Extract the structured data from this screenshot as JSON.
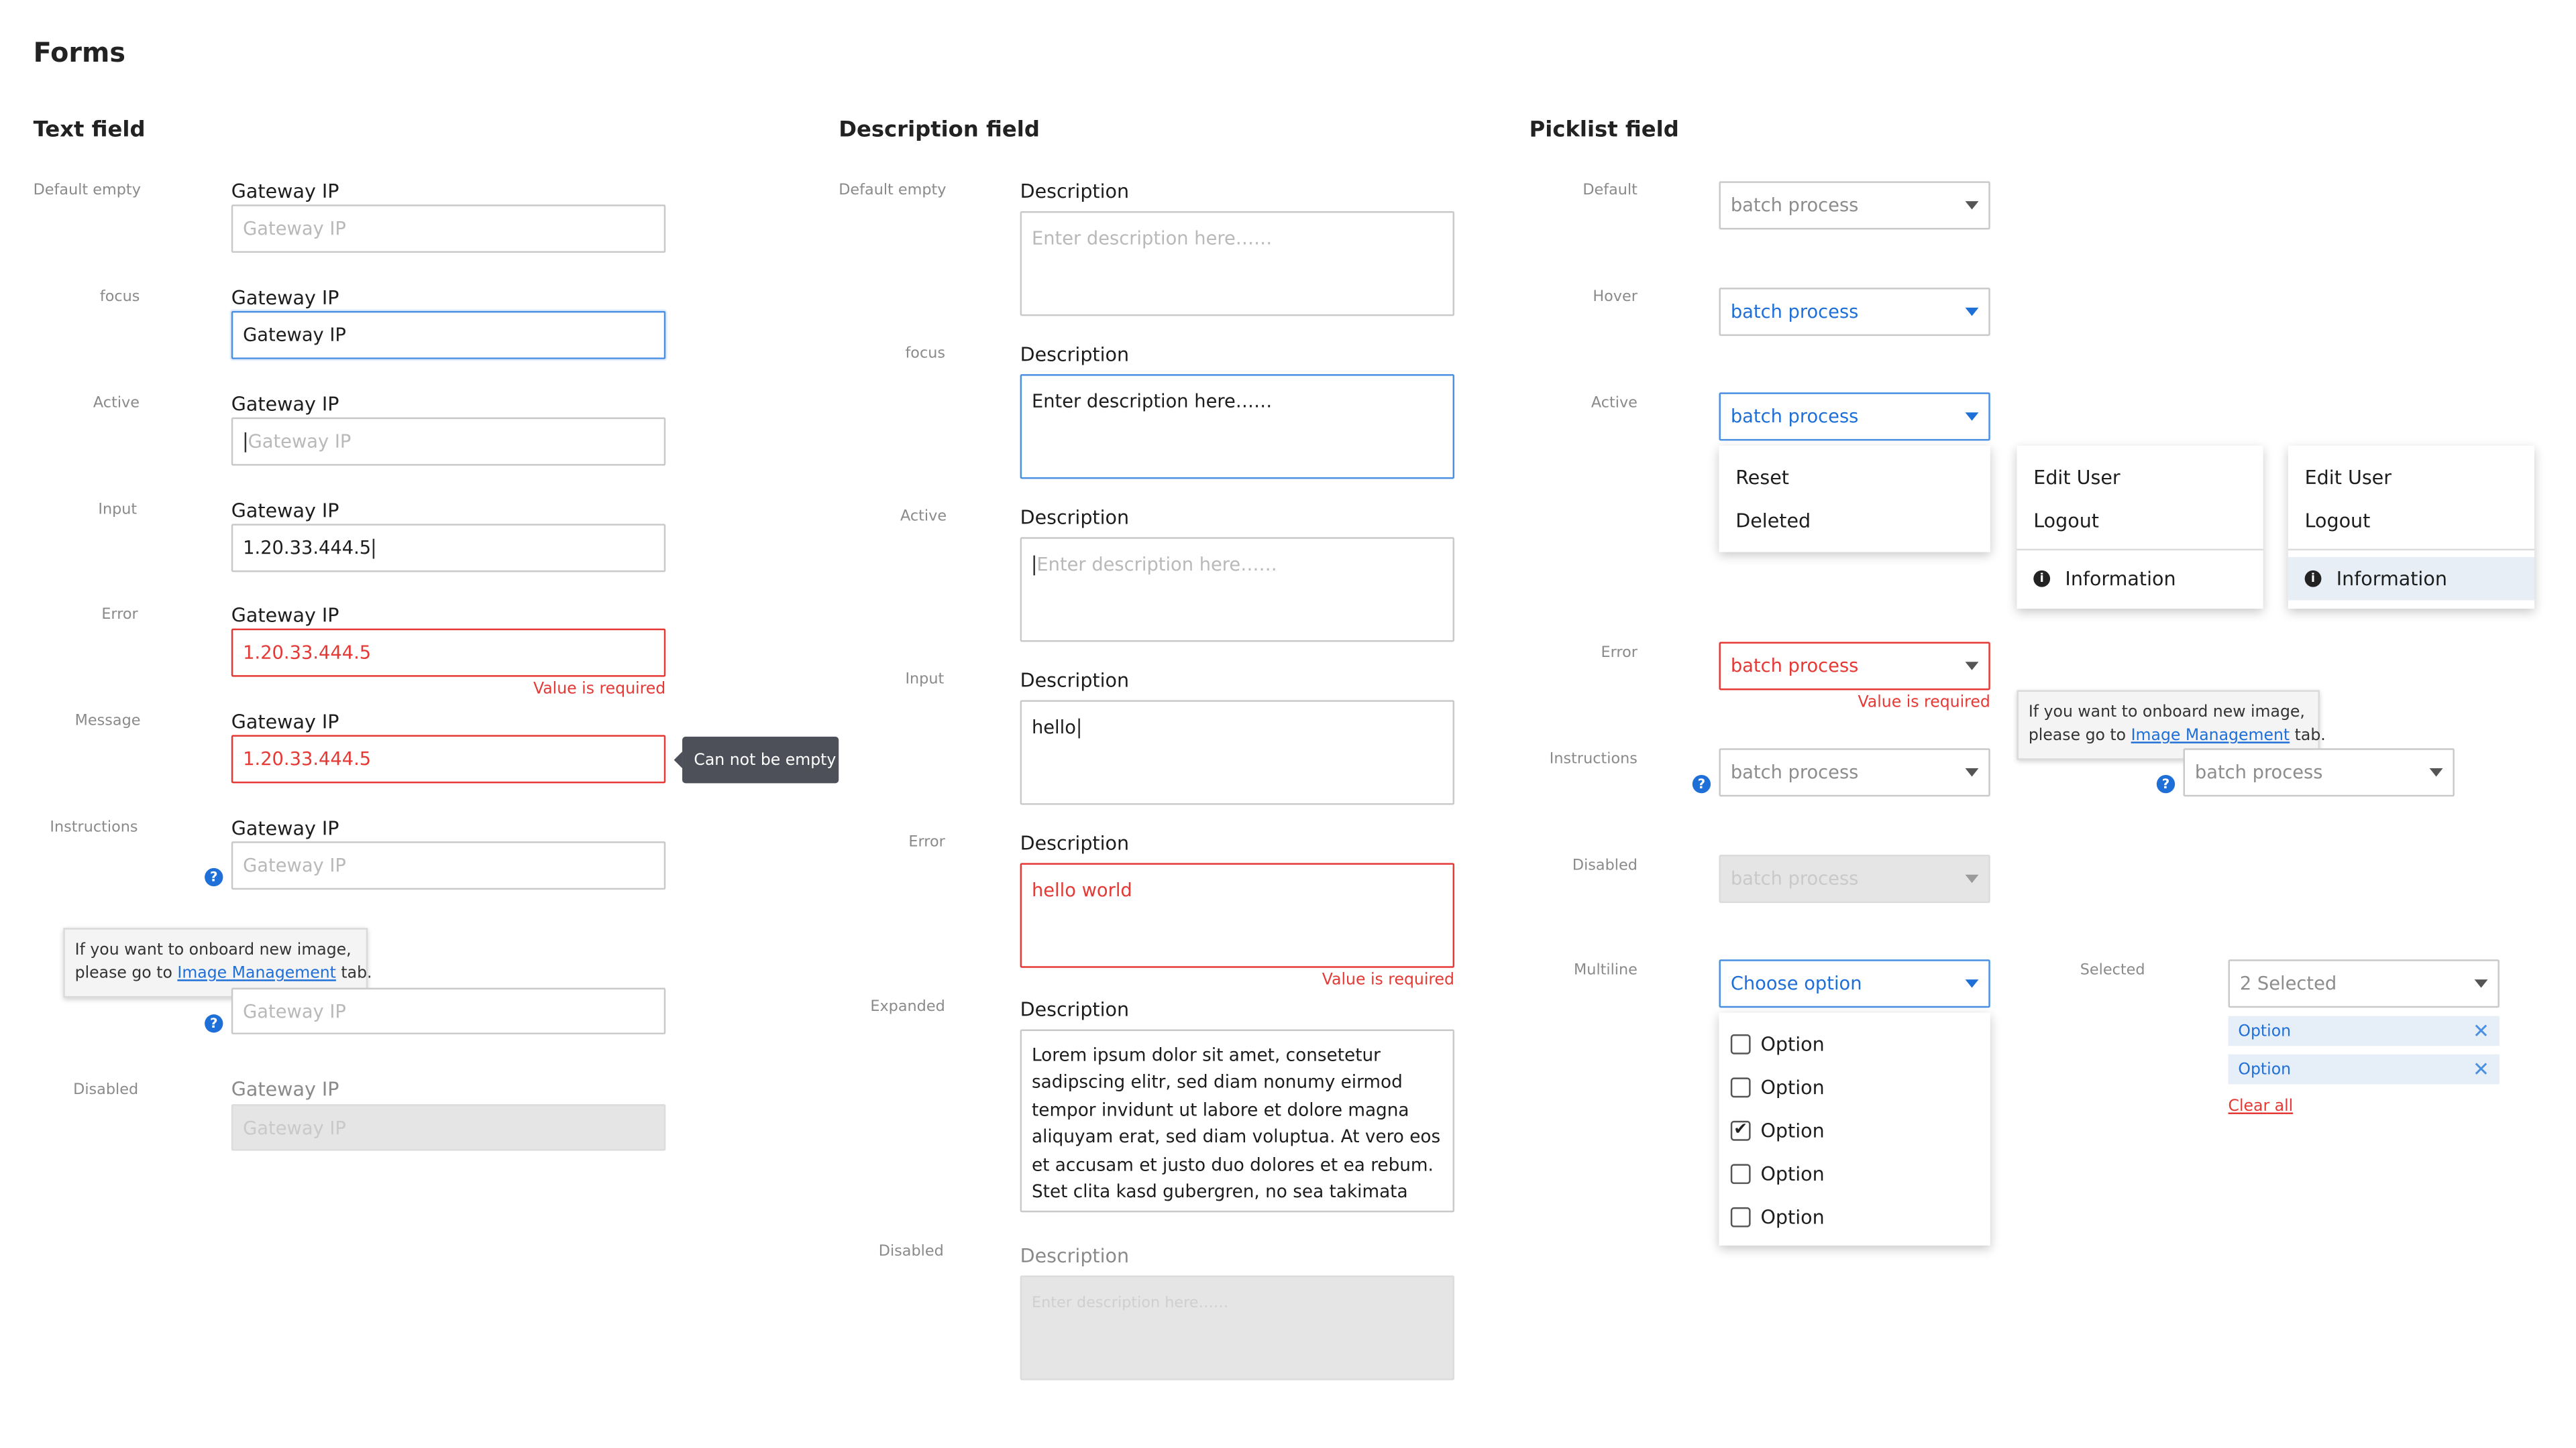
{
  "page_title": "Forms",
  "text_field": {
    "section_title": "Text field",
    "field_label": "Gateway IP",
    "placeholder": "Gateway IP",
    "states": {
      "default_empty": "Default empty",
      "focus": "focus",
      "active": "Active",
      "input": "Input",
      "error": "Error",
      "message": "Message",
      "instructions": "Instructions",
      "disabled": "Disabled"
    },
    "focus_value": "Gateway IP",
    "input_value": "1.20.33.444.5",
    "error_value": "1.20.33.444.5",
    "error_message": "Value is required",
    "message_value": "1.20.33.444.5",
    "message_tooltip": "Can not be empty",
    "help_icon": "?",
    "tooltip": {
      "line1": "If you want to onboard new image,",
      "line2_prefix": "please go to ",
      "link": "Image Management",
      "line2_suffix": " tab."
    }
  },
  "description_field": {
    "section_title": "Description field",
    "field_label": "Description",
    "placeholder": "Enter description here……",
    "states": {
      "default_empty": "Default empty",
      "focus": "focus",
      "active": "Active",
      "input": "Input",
      "error": "Error",
      "expanded": "Expanded",
      "disabled": "Disabled"
    },
    "focus_value": "Enter description here……",
    "input_value": "hello",
    "error_value": "hello world",
    "error_message": "Value is required",
    "expanded_lines": [
      "Lorem ipsum dolor sit amet, consetetur",
      "sadipscing elitr, sed diam nonumy eirmod",
      "tempor invidunt ut labore et dolore magna",
      "aliquyam erat, sed diam voluptua. At vero eos",
      "et accusam et justo duo dolores et ea rebum.",
      "Stet clita kasd gubergren, no sea takimata"
    ]
  },
  "picklist_field": {
    "section_title": "Picklist field",
    "states": {
      "default": "Default",
      "hover": "Hover",
      "active": "Active",
      "error": "Error",
      "instructions": "Instructions",
      "disabled": "Disabled",
      "multiline": "Multiline",
      "selected": "Selected"
    },
    "value": "batch process",
    "error_message": "Value is required",
    "active_menu": [
      "Reset",
      "Deleted"
    ],
    "menu_2": {
      "items": [
        "Edit User",
        "Logout"
      ],
      "info": "Information"
    },
    "menu_3": {
      "items": [
        "Edit User",
        "Logout"
      ],
      "info": "Information"
    },
    "info_icon": "i",
    "multiline_placeholder": "Choose option",
    "multiline_options": [
      {
        "label": "Option",
        "checked": false
      },
      {
        "label": "Option",
        "checked": false
      },
      {
        "label": "Option",
        "checked": true
      },
      {
        "label": "Option",
        "checked": false
      },
      {
        "label": "Option",
        "checked": false
      }
    ],
    "checkmark": "✔",
    "selected_summary": "2 Selected",
    "selected_chips": [
      "Option",
      "Option"
    ],
    "chip_remove": "✕",
    "clear_all": "Clear all"
  },
  "colors": {
    "accent": "#1f6fd8",
    "focus_border": "#4a90e2",
    "error": "#e53935",
    "disabled_bg": "#e5e5e5",
    "chip_bg": "#e6eef7",
    "dark_tooltip": "#4d5058"
  }
}
